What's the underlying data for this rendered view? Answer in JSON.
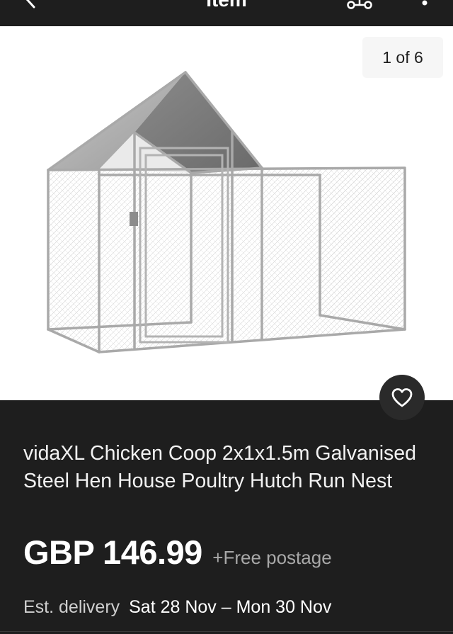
{
  "header": {
    "title": "Item",
    "back_icon": "chevron-left-icon",
    "share_icon": "share-icon",
    "more_icon": "more-vertical-icon"
  },
  "gallery": {
    "counter": "1 of 6",
    "image_alt": "Galvanised steel chicken coop with peaked roof and wire mesh run"
  },
  "favorite": {
    "icon": "heart-icon"
  },
  "listing": {
    "title": "vidaXL Chicken Coop 2x1x1.5m Galvanised Steel Hen House Poultry Hutch Run Nest",
    "price": "GBP 146.99",
    "postage": "+Free postage",
    "delivery_label": "Est. delivery",
    "delivery_dates": "Sat 28 Nov – Mon 30 Nov"
  },
  "colors": {
    "background": "#1e1e1e",
    "image_background": "#ffffff",
    "muted_text": "#a8a8a8"
  }
}
